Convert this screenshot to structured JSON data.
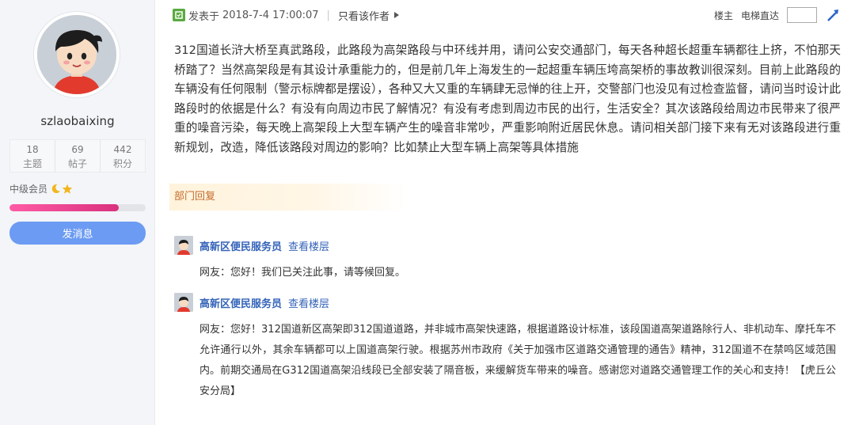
{
  "sidebar": {
    "username": "szlaobaixing",
    "stats": [
      {
        "value": "18",
        "label": "主题"
      },
      {
        "value": "69",
        "label": "帖子"
      },
      {
        "value": "442",
        "label": "积分"
      }
    ],
    "level": "中级会员",
    "level_progress": 0.8,
    "message_button": "发消息",
    "avatar_icon": "cartoon-face-avatar",
    "level_icons": [
      "moon-icon",
      "star-icon"
    ]
  },
  "post": {
    "header": {
      "posted_label": "发表于",
      "datetime": "2018-7-4 17:00:07",
      "only_author": "只看该作者",
      "floor_label": "楼主",
      "elevator_label": "电梯直达"
    },
    "body": "312国道长浒大桥至真武路段，此路段为高架路段与中环线并用，请问公安交通部门，每天各种超长超重车辆都往上挤，不怕那天桥踏了？当然高架段是有其设计承重能力的，但是前几年上海发生的一起超重车辆压垮高架桥的事故教训很深刻。目前上此路段的车辆没有任何限制（警示标牌都是摆设），各种又大又重的车辆肆无忌惮的往上开，交警部门也没见有过检查监督，请问当时设计此路段时的依据是什么？有没有向周边市民了解情况？有没有考虑到周边市民的出行，生活安全？其次该路段给周边市民带来了很严重的噪音污染，每天晚上高架段上大型车辆产生的噪音非常吵，严重影响附近居民休息。请问相关部门接下来有无对该路段进行重新规划，改造，降低该路段对周边的影响？比如禁止大型车辆上高架等具体措施"
  },
  "replies_section": {
    "title": "部门回复",
    "replies": [
      {
        "name": "高新区便民服务员",
        "view_floor": "查看楼层",
        "text": "网友：您好！我们已关注此事，请等候回复。"
      },
      {
        "name": "高新区便民服务员",
        "view_floor": "查看楼层",
        "text": "网友：您好！312国道新区高架即312国道道路，并非城市高架快速路，根据道路设计标准，该段国道高架道路除行人、非机动车、摩托车不允许通行以外，其余车辆都可以上国道高架行驶。根据苏州市政府《关于加强市区道路交通管理的通告》精神，312国道不在禁鸣区域范围内。前期交通局在G312国道高架沿线段已全部安装了隔音板，来缓解货车带来的噪音。感谢您对道路交通管理工作的关心和支持！【虎丘公安分局】"
      }
    ]
  },
  "colors": {
    "sidebar_bg": "#f3f5f8",
    "accent_blue": "#6c9bf3",
    "link_blue": "#3463b8",
    "reply_tag_text": "#c36b2b",
    "progress_pink": "#e0428c"
  }
}
